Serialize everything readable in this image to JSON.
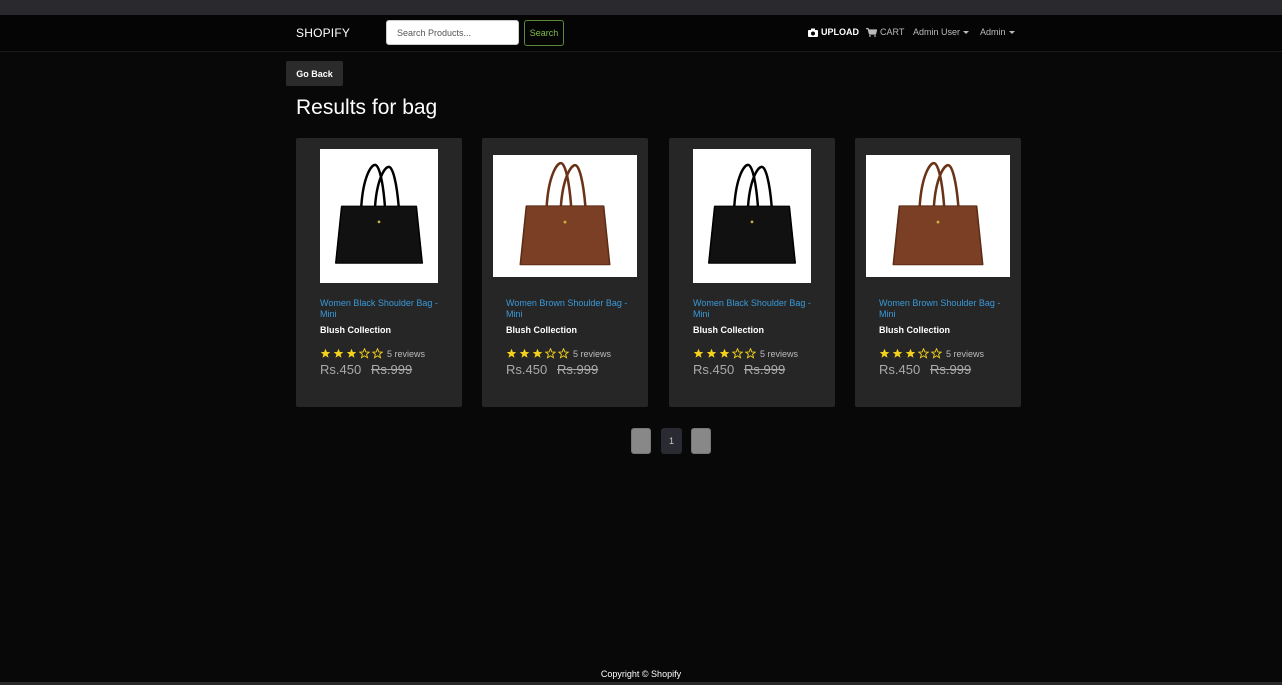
{
  "navbar": {
    "brand": "SHOPIFY",
    "search_placeholder": "Search Products...",
    "search_label": "Search",
    "upload_label": "UPLOAD",
    "cart_label": "CART",
    "user_label": "Admin User",
    "admin_label": "Admin"
  },
  "main": {
    "go_back_label": "Go Back",
    "title": "Results for bag"
  },
  "products": [
    {
      "name": "Women Black Shoulder Bag - Mini",
      "brand": "Blush Collection",
      "rating": 3,
      "reviews": "5 reviews",
      "price": "Rs.450",
      "old_price": "Rs.999",
      "color": "black"
    },
    {
      "name": "Women Brown Shoulder Bag - Mini",
      "brand": "Blush Collection",
      "rating": 3,
      "reviews": "5 reviews",
      "price": "Rs.450",
      "old_price": "Rs.999",
      "color": "brown"
    },
    {
      "name": "Women Black Shoulder Bag - Mini",
      "brand": "Blush Collection",
      "rating": 3,
      "reviews": "5 reviews",
      "price": "Rs.450",
      "old_price": "Rs.999",
      "color": "black"
    },
    {
      "name": "Women Brown Shoulder Bag - Mini",
      "brand": "Blush Collection",
      "rating": 3,
      "reviews": "5 reviews",
      "price": "Rs.450",
      "old_price": "Rs.999",
      "color": "brown"
    }
  ],
  "pagination": {
    "current": "1"
  },
  "footer": {
    "copyright": "Copyright © Shopify"
  },
  "colors": {
    "star": "#f5d21b",
    "link": "#3a9ad9",
    "card_bg": "#262626",
    "search_accent": "#7fbf4a"
  }
}
